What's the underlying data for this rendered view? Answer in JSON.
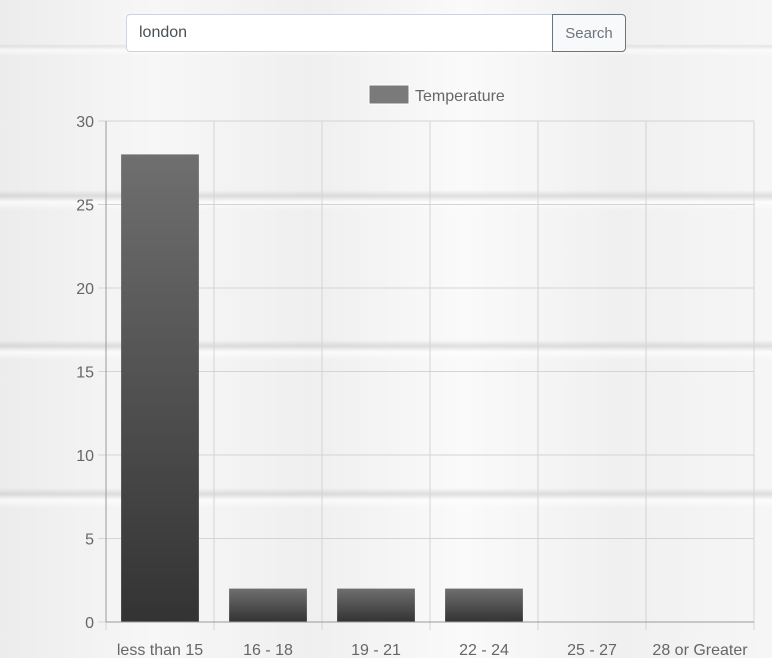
{
  "search": {
    "value": "london",
    "button_label": "Search"
  },
  "chart_data": {
    "type": "bar",
    "categories": [
      "less than 15",
      "16 - 18",
      "19 - 21",
      "22 - 24",
      "25 - 27",
      "28 or Greater"
    ],
    "series": [
      {
        "name": "Temperature",
        "values": [
          28,
          2,
          2,
          2,
          0,
          0
        ]
      }
    ],
    "ylim": [
      0,
      30
    ],
    "yticks": [
      0,
      5,
      10,
      15,
      20,
      25,
      30
    ],
    "grid": true,
    "legend": "top",
    "colors": {
      "bar_top": "#6f6f6f",
      "bar_bottom": "#333333",
      "legend_swatch": "#7a7a7a"
    }
  }
}
